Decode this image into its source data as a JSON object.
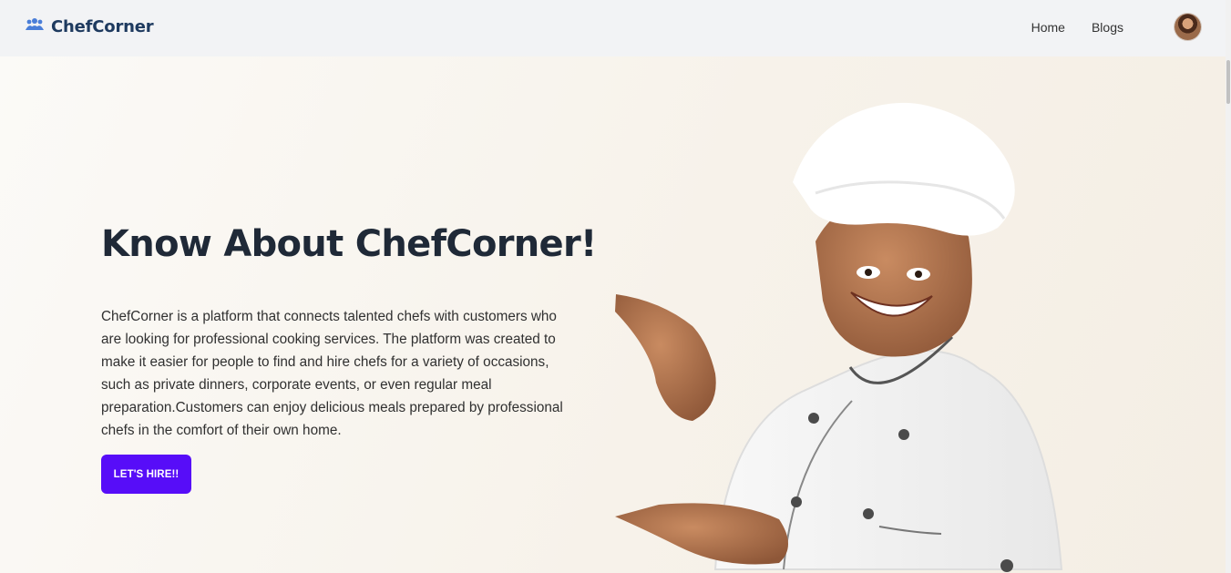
{
  "navbar": {
    "brand": "ChefCorner",
    "brand_icon": "users-icon",
    "links": [
      "Home",
      "Blogs"
    ],
    "avatar_icon": "user-avatar"
  },
  "hero": {
    "title": "Know About ChefCorner!",
    "description": "ChefCorner is a platform that connects talented chefs with customers who are looking for professional cooking services. The platform was created to make it easier for people to find and hire chefs for a variety of occasions, such as private dinners, corporate events, or even regular meal preparation.Customers can enjoy delicious meals prepared by professional chefs in the comfort of their own home.",
    "cta": "LET'S HIRE!!",
    "image": "chef-pointing-photo"
  },
  "colors": {
    "accent": "#570df8",
    "brand_text": "#1e3a5f",
    "brand_icon": "#4a7ed8",
    "navbar_bg": "#f2f3f5"
  }
}
